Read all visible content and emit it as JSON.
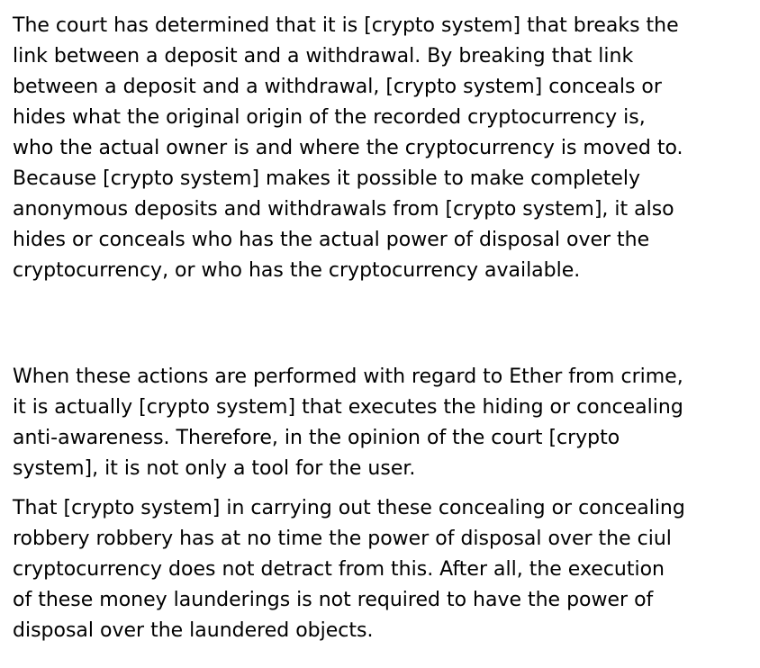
{
  "paragraphs": [
    {
      "lines": [
        "The court has determined that it is [crypto system] that breaks the",
        "link between a deposit and a withdrawal. By breaking that link",
        "between a deposit and a withdrawal, [crypto system] conceals or",
        "hides what the original origin of the recorded cryptocurrency is,",
        "who the actual owner is and where the cryptocurrency is moved to.",
        "Because [crypto system] makes it possible to make completely",
        "anonymous deposits and withdrawals from [crypto system], it also",
        "hides or conceals who has the actual power of disposal over the",
        "cryptocurrency, or who has the cryptocurrency available."
      ]
    },
    {
      "lines": [
        "When these actions are performed with regard to Ether from crime,",
        "it is actually [crypto system] that executes the hiding or concealing",
        "anti-awareness. Therefore, in the opinion of the court [crypto",
        "system], it is not only a tool for the user."
      ]
    },
    {
      "lines": [
        "That [crypto system] in carrying out these concealing or concealing",
        "robbery robbery has at no time the power of disposal over the ciul",
        "cryptocurrency does not detract from this. After all, the execution",
        "of these money launderings is not required to have the power of",
        "disposal over the laundered objects."
      ]
    }
  ]
}
